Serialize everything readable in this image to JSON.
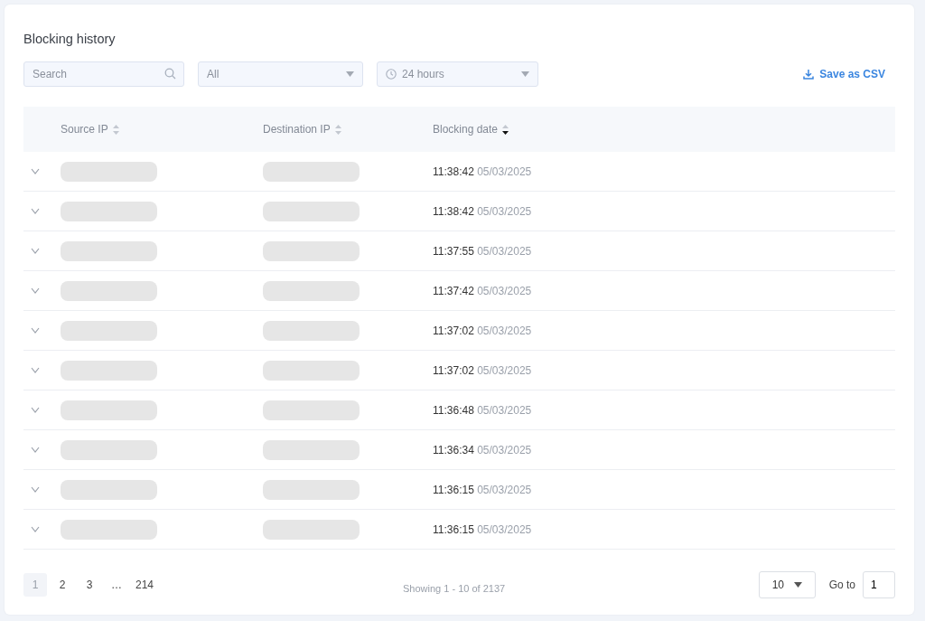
{
  "title": "Blocking history",
  "search": {
    "placeholder": "Search"
  },
  "filters": [
    {
      "kind": "plain",
      "value": "All"
    },
    {
      "kind": "time",
      "value": "24 hours"
    }
  ],
  "export": {
    "label": "Save as CSV"
  },
  "table": {
    "columns": [
      {
        "label": "Source IP",
        "sorted": false
      },
      {
        "label": "Destination IP",
        "sorted": false
      },
      {
        "label": "Blocking date",
        "sorted": true
      }
    ],
    "rows": [
      {
        "expanded": false,
        "time": "11:38:42",
        "date": "05/03/2025"
      },
      {
        "expanded": false,
        "time": "11:38:42",
        "date": "05/03/2025"
      },
      {
        "expanded": false,
        "time": "11:37:55",
        "date": "05/03/2025"
      },
      {
        "expanded": false,
        "time": "11:37:42",
        "date": "05/03/2025"
      },
      {
        "expanded": false,
        "time": "11:37:02",
        "date": "05/03/2025"
      },
      {
        "expanded": false,
        "time": "11:37:02",
        "date": "05/03/2025"
      },
      {
        "expanded": false,
        "time": "11:36:48",
        "date": "05/03/2025"
      },
      {
        "expanded": false,
        "time": "11:36:34",
        "date": "05/03/2025"
      },
      {
        "expanded": false,
        "time": "11:36:15",
        "date": "05/03/2025"
      },
      {
        "expanded": false,
        "time": "11:36:15",
        "date": "05/03/2025"
      }
    ]
  },
  "pagination": {
    "pages": [
      {
        "label": "1",
        "selected": true
      },
      {
        "label": "2",
        "selected": false
      },
      {
        "label": "3",
        "selected": false
      },
      {
        "label": "…",
        "selected": false
      },
      {
        "label": "214",
        "selected": false
      }
    ],
    "summary": "Showing 1 - 10 of 2137",
    "page_size": "10",
    "goto_label": "Go to",
    "goto_value": "1"
  }
}
